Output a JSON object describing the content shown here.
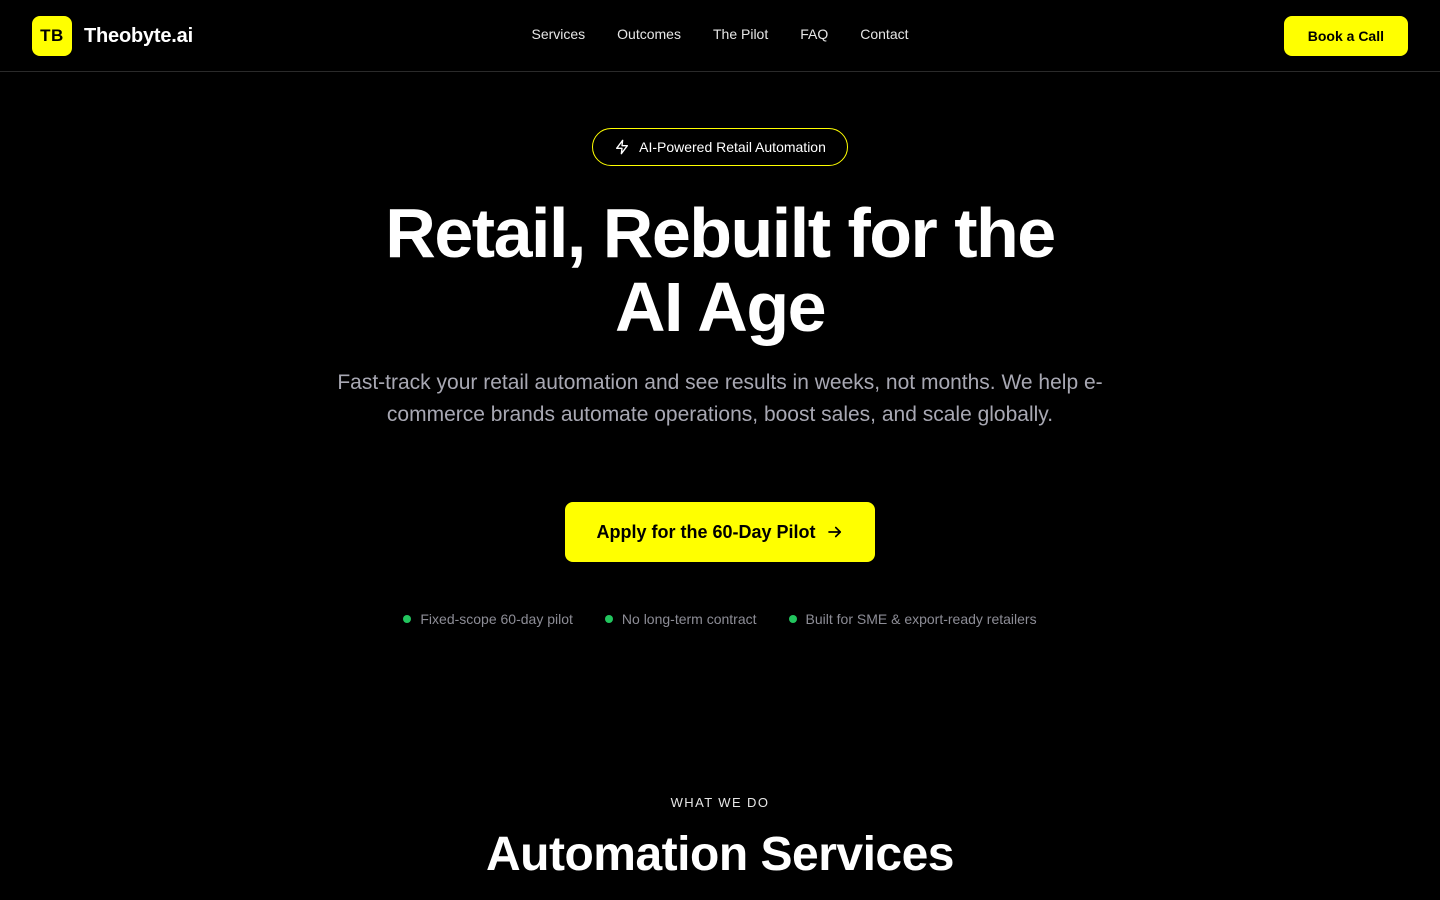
{
  "nav": {
    "logo_mark": "TB",
    "brand": "Theobyte.ai",
    "links": [
      "Services",
      "Outcomes",
      "The Pilot",
      "FAQ",
      "Contact"
    ],
    "cta_label": "Book a Call"
  },
  "hero": {
    "badge_icon": "lightning-icon",
    "badge_label": "AI-Powered Retail Automation",
    "title_line1": "Retail, Rebuilt for the",
    "title_line2": "AI Age",
    "subtitle": "Fast-track your retail automation and see results in weeks, not months. We help e-commerce brands automate operations, boost sales, and scale globally.",
    "cta_label": "Apply for the 60-Day Pilot",
    "cta_icon": "arrow-right-icon",
    "benefits": [
      "Fixed-scope 60-day pilot",
      "No long-term contract",
      "Built for SME & export-ready retailers"
    ]
  },
  "services": {
    "eyebrow": "WHAT WE DO",
    "title": "Automation Services"
  },
  "colors": {
    "background": "#000000",
    "accent": "#ffff00",
    "status_dot": "#22c55e",
    "muted_text": "#a8a8b3"
  }
}
